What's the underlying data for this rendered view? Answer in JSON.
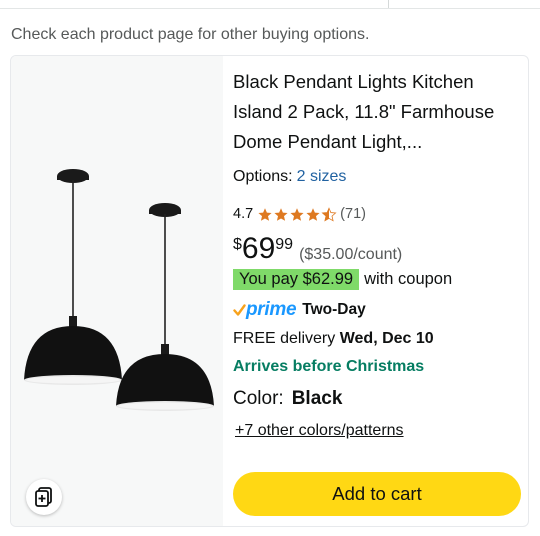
{
  "notice": "Check each product page for other buying options.",
  "product": {
    "title": "Black Pendant Lights Kitchen Island 2 Pack, 11.8\" Farmhouse Dome Pendant Light,...",
    "image_alt_icon": "pendant-lights-product-image",
    "options_label": "Options:",
    "options_value": "2 sizes",
    "rating_value": "4.7",
    "rating_stars": 4.5,
    "rating_count": "(71)",
    "price_symbol": "$",
    "price_whole": "69",
    "price_fraction": "99",
    "price_per_unit": "($35.00/count)",
    "coupon_badge": "You pay $62.99",
    "coupon_suffix": "with coupon",
    "prime_check": "✓",
    "prime_word": "prime",
    "prime_speed": "Two-Day",
    "delivery_prefix": "FREE delivery",
    "delivery_date": "Wed, Dec 10",
    "arrives_text": "Arrives before Christmas",
    "color_label": "Color:",
    "color_value": "Black",
    "more_colors": "+7 other colors/patterns",
    "add_to_cart": "Add to cart"
  },
  "colors": {
    "star": "#de7921",
    "link": "#2162a1",
    "coupon_badge_bg": "#7fda69",
    "prime_blue": "#1a98ff",
    "prime_check": "#f7a21c",
    "arrives_green": "#067d62",
    "cart_button": "#ffd814",
    "image_bg": "#f7f8f8"
  },
  "icons": {
    "compare": "compare-icon",
    "star": "star-icon"
  }
}
